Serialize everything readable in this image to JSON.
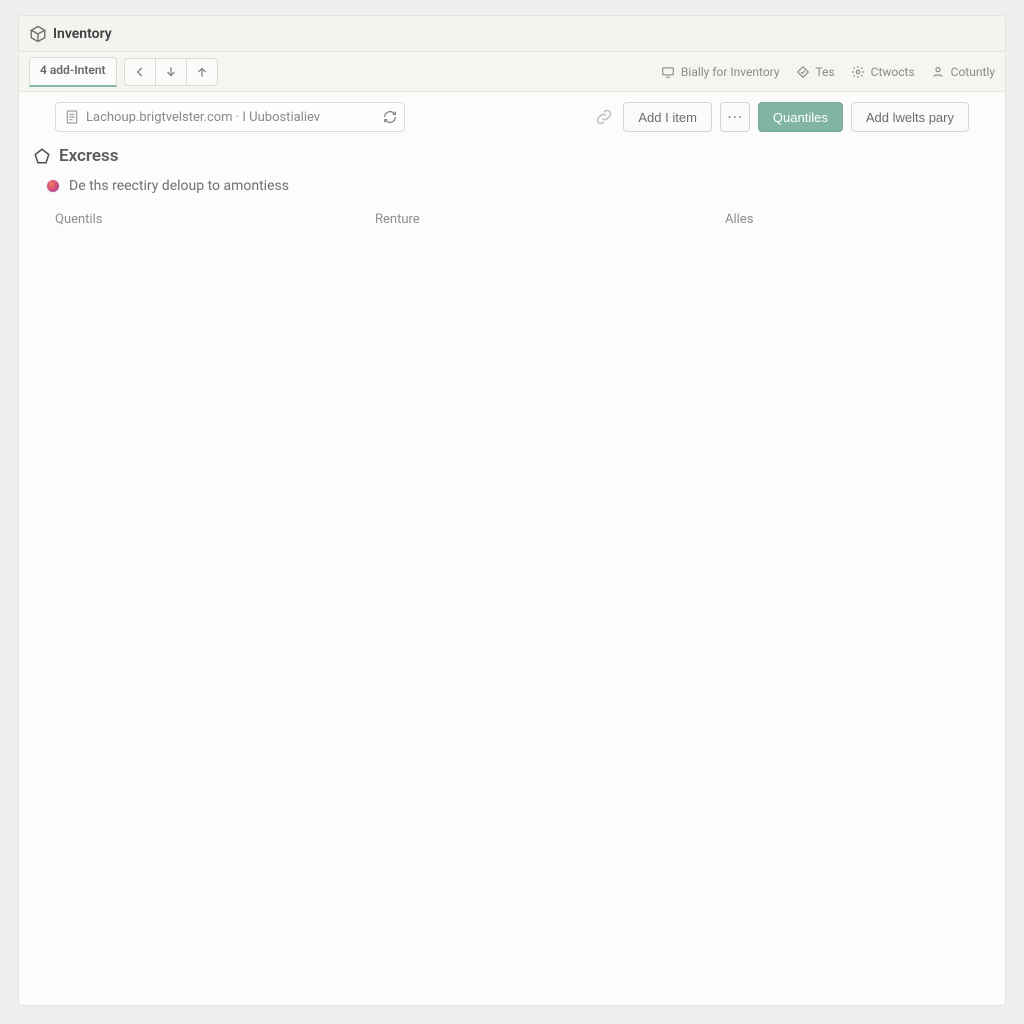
{
  "titlebar": {
    "app_title": "Inventory"
  },
  "toolbar": {
    "tab_label": "4 add-Intent",
    "links": {
      "inventory": "Bially for Inventory",
      "tes": "Tes",
      "contacts": "Ctwocts",
      "country": "Cotuntly"
    }
  },
  "address": {
    "text": "Lachoup.brigtvelster.com · I Uubostialiev"
  },
  "actions": {
    "add_item": "Add I item",
    "quantities": "Quantiles",
    "add_party": "Add lwelts pary"
  },
  "section": {
    "title": "Excress",
    "subtitle": "De ths reectiry deloup to amontiess"
  },
  "columns": {
    "c1": "Quentils",
    "c2": "Renture",
    "c3": "Alles"
  }
}
